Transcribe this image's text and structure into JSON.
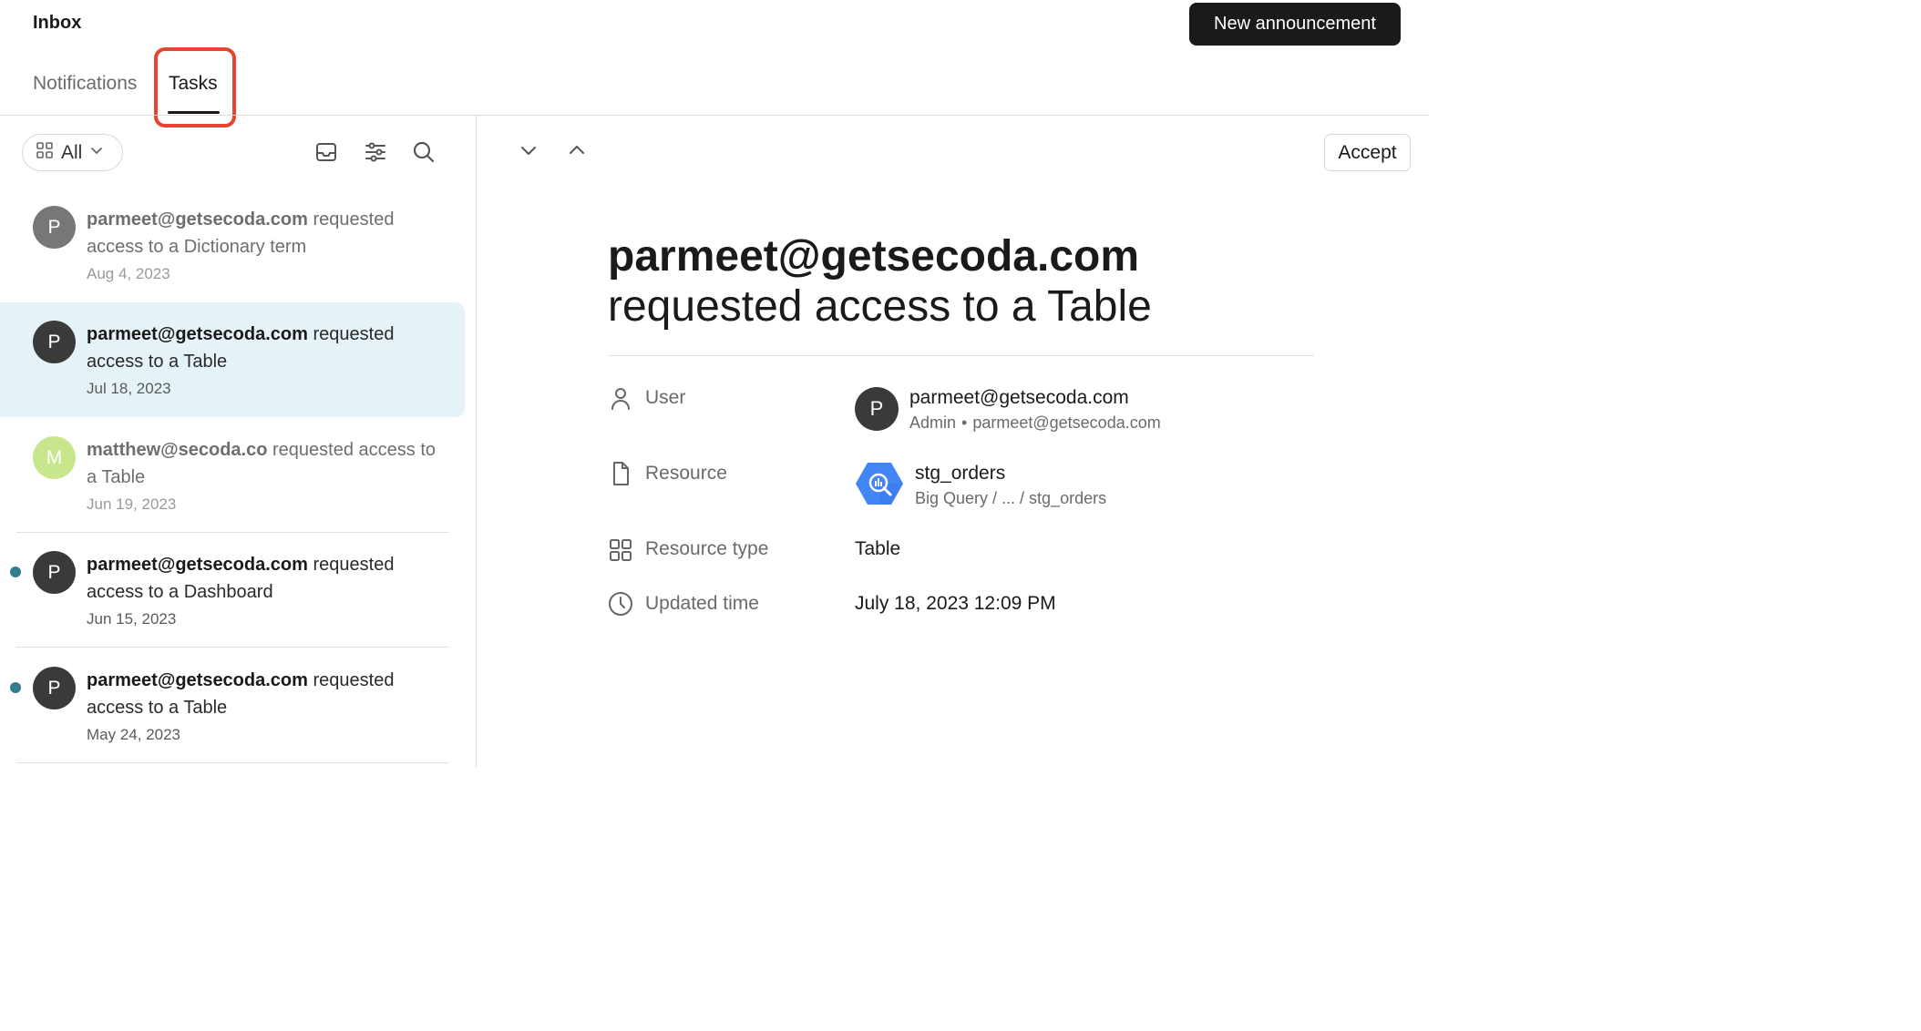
{
  "header": {
    "title": "Inbox",
    "new_announcement": "New announcement"
  },
  "tabs": {
    "notifications": "Notifications",
    "tasks": "Tasks"
  },
  "toolbar": {
    "filter_label": "All"
  },
  "list": [
    {
      "user": "parmeet@getsecoda.com",
      "action": "requested access to a Dictionary term",
      "date": "Aug 4, 2023",
      "initial": "P"
    },
    {
      "user": "parmeet@getsecoda.com",
      "action": "requested access to a Table",
      "date": "Jul 18, 2023",
      "initial": "P"
    },
    {
      "user": "matthew@secoda.co",
      "action": "requested access to a Table",
      "date": "Jun 19, 2023",
      "initial": "M"
    },
    {
      "user": "parmeet@getsecoda.com",
      "action": "requested access to a Dashboard",
      "date": "Jun 15, 2023",
      "initial": "P"
    },
    {
      "user": "parmeet@getsecoda.com",
      "action": "requested access to a Table",
      "date": "May 24, 2023",
      "initial": "P"
    }
  ],
  "detail": {
    "accept": "Accept",
    "title_user": "parmeet@getsecoda.com",
    "title_action": "requested access to a Table",
    "labels": {
      "user": "User",
      "resource": "Resource",
      "resource_type": "Resource type",
      "updated_time": "Updated time"
    },
    "user": {
      "initial": "P",
      "email": "parmeet@getsecoda.com",
      "role": "Admin",
      "separator": "•",
      "sub_email": "parmeet@getsecoda.com"
    },
    "resource": {
      "name": "stg_orders",
      "path": "Big Query / ... / stg_orders"
    },
    "resource_type": "Table",
    "updated_time": "July 18, 2023 12:09 PM"
  },
  "colors": {
    "accent_highlight": "#e8432e",
    "selected_bg": "#e5f3f8",
    "unread_dot": "#2f7d8e",
    "avatar_dark": "#3a3a3a",
    "avatar_gray": "#777777",
    "avatar_green": "#c8e68c",
    "bigquery_blue": "#4285f4"
  }
}
